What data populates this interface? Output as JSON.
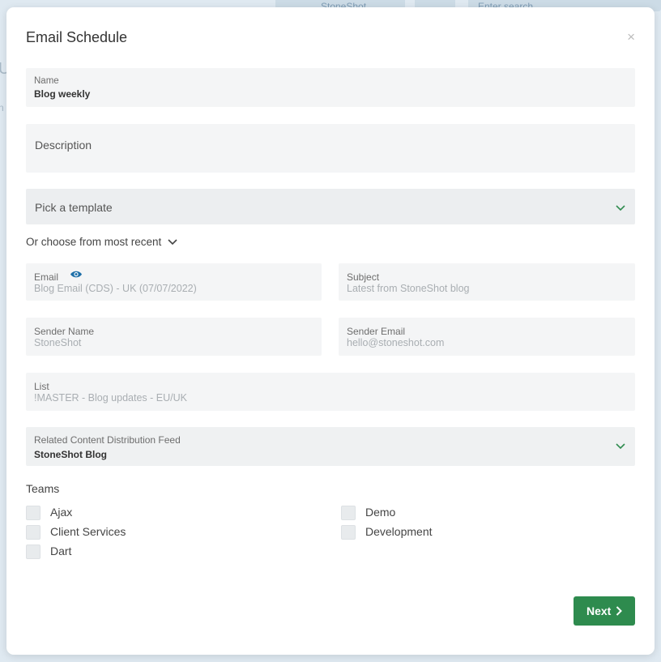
{
  "background": {
    "tab1": "StoneShot",
    "search_placeholder": "Enter search",
    "left_letters": [
      "U",
      "n"
    ]
  },
  "modal": {
    "title": "Email Schedule",
    "close_glyph": "×"
  },
  "fields": {
    "name": {
      "label": "Name",
      "value": "Blog weekly"
    },
    "description": {
      "placeholder": "Description"
    },
    "template": {
      "placeholder": "Pick a template"
    },
    "recent_toggle": "Or choose from most recent",
    "email": {
      "label": "Email",
      "value": "Blog Email (CDS) - UK (07/07/2022)"
    },
    "subject": {
      "label": "Subject",
      "value": "Latest from StoneShot blog"
    },
    "sender_name": {
      "label": "Sender Name",
      "value": "StoneShot"
    },
    "sender_email": {
      "label": "Sender Email",
      "value": "hello@stoneshot.com"
    },
    "list": {
      "label": "List",
      "value": "!MASTER - Blog updates - EU/UK"
    },
    "feed": {
      "label": "Related Content Distribution Feed",
      "value": "StoneShot Blog"
    }
  },
  "teams": {
    "title": "Teams",
    "items": [
      "Ajax",
      "Client Services",
      "Dart",
      "Demo",
      "Development"
    ]
  },
  "footer": {
    "next_label": "Next"
  },
  "colors": {
    "accent": "#2e8b4e",
    "eye_icon": "#1e6fa8",
    "field_bg": "#f4f5f6"
  }
}
